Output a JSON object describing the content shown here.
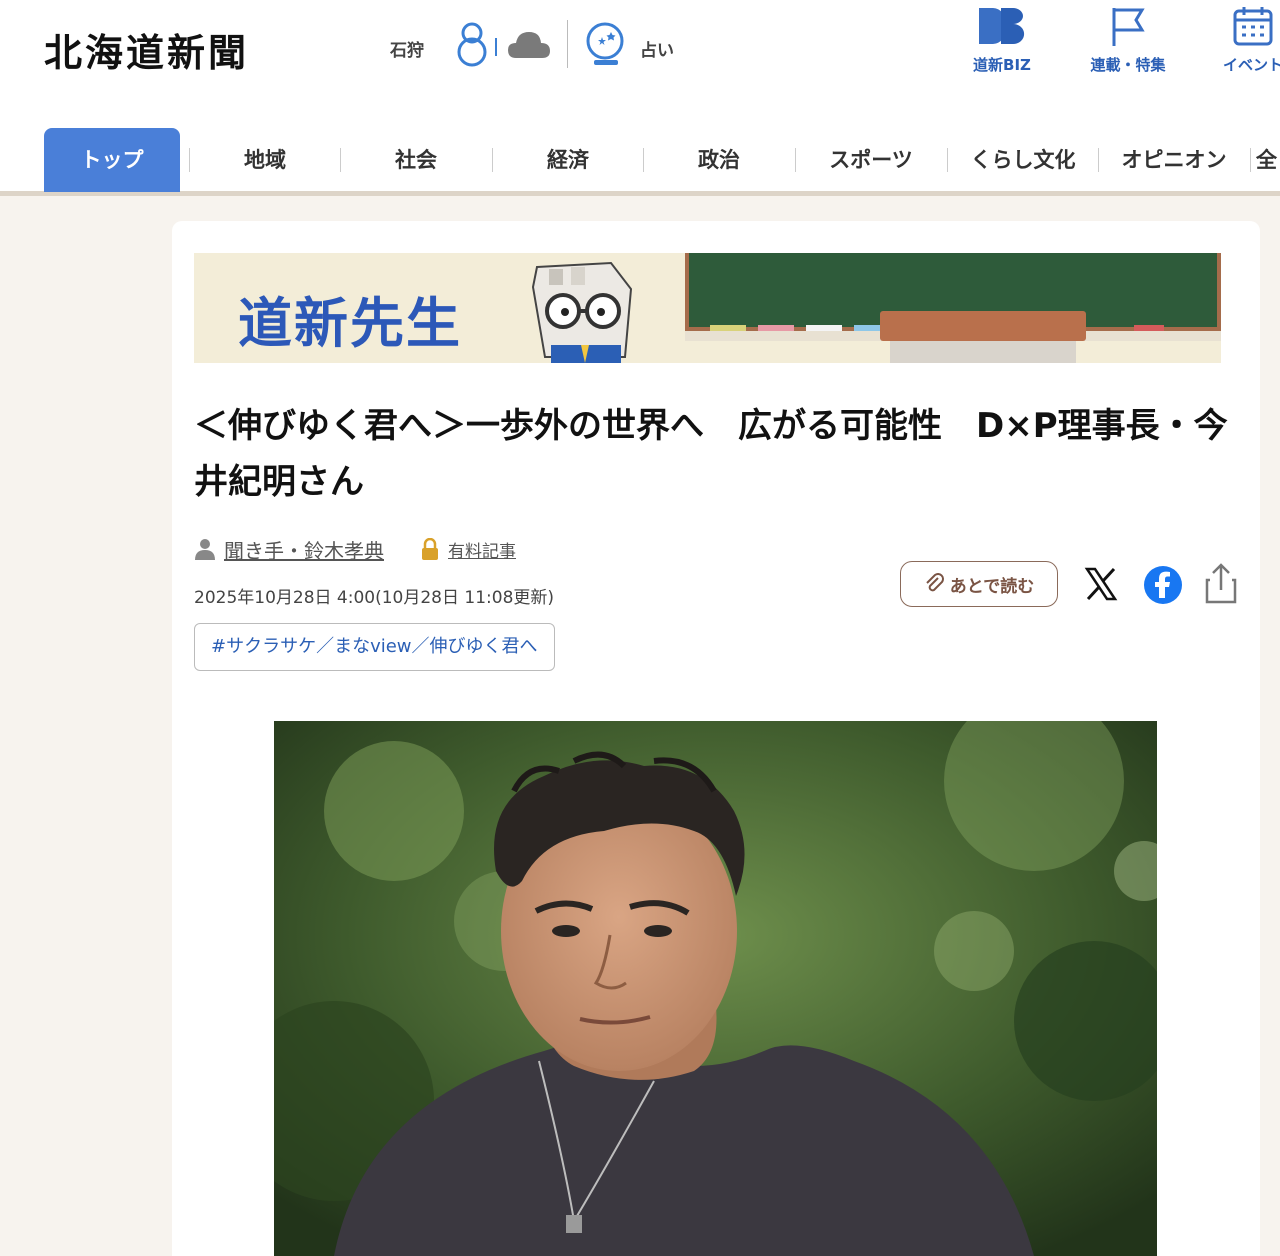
{
  "header": {
    "logo": "北海道新聞",
    "city": "石狩",
    "uranai": "占い",
    "links": [
      {
        "label": "道新BIZ",
        "icon": "db-logo-icon"
      },
      {
        "label": "連載・特集",
        "icon": "flag-icon"
      },
      {
        "label": "イベント",
        "icon": "calendar-icon"
      }
    ]
  },
  "nav": {
    "items": [
      "トップ",
      "地域",
      "社会",
      "経済",
      "政治",
      "スポーツ",
      "くらし文化",
      "オピニオン",
      "全"
    ],
    "active_index": 0
  },
  "banner": {
    "text": "道新先生"
  },
  "article": {
    "title": "＜伸びゆく君へ＞一歩外の世界へ　広がる可能性　D×P理事長・今井紀明さん",
    "author": "聞き手・鈴木孝典",
    "paid_label": "有料記事",
    "date": "2025年10月28日 4:00(10月28日 11:08更新)",
    "read_later": "あとで読む",
    "tag": "#サクラサケ／まなview／伸びゆく君へ"
  },
  "colors": {
    "accent": "#4a7fd8",
    "link": "#2b5fb5",
    "background": "#f7f3ee"
  }
}
